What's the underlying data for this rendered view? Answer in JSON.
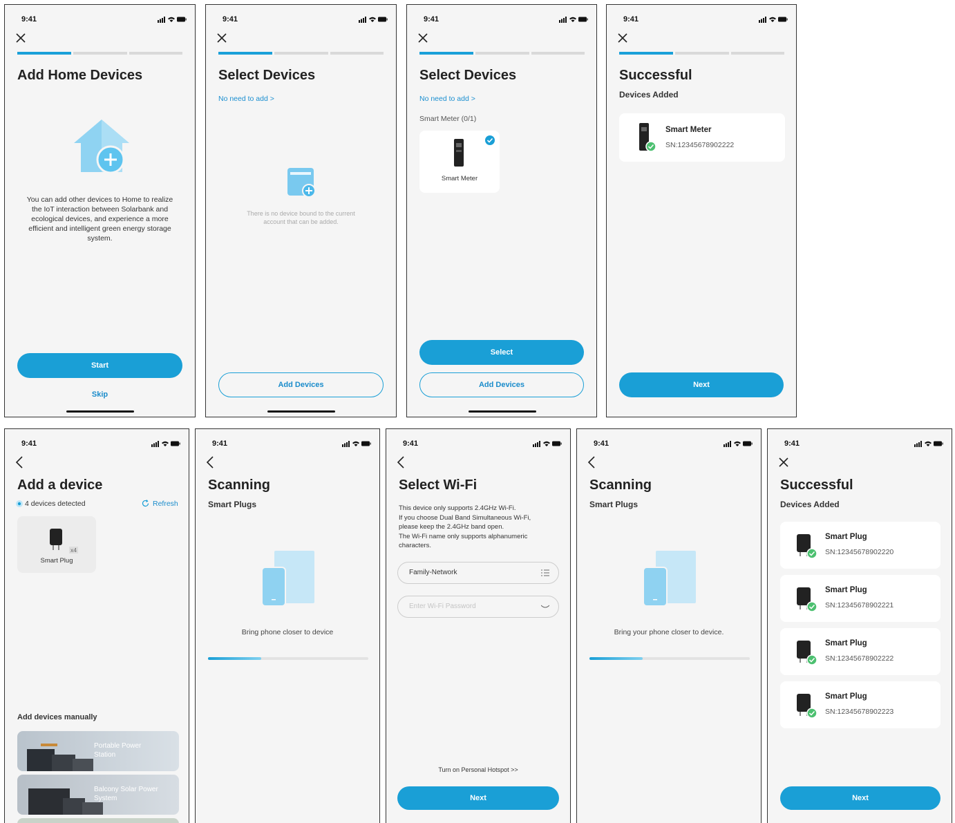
{
  "status_time": "9:41",
  "screens": {
    "s1": {
      "title": "Add Home Devices",
      "desc": "You can add other devices to Home to realize the IoT interaction between Solarbank and ecological devices, and experience a more efficient and intelligent green energy storage system.",
      "start": "Start",
      "skip": "Skip"
    },
    "s2": {
      "title": "Select Devices",
      "link": "No need to add >",
      "empty": "There is no device bound to the current account that can be added.",
      "add": "Add Devices"
    },
    "s3": {
      "title": "Select Devices",
      "link": "No need to add >",
      "group": "Smart Meter (0/1)",
      "device": "Smart Meter",
      "select": "Select",
      "add": "Add Devices"
    },
    "s4": {
      "title": "Successful",
      "subtitle": "Devices Added",
      "device": "Smart Meter",
      "sn": "SN:12345678902222",
      "next": "Next"
    },
    "s5": {
      "title": "Add a device",
      "detected": "4 devices detected",
      "refresh": "Refresh",
      "device": "Smart Plug",
      "count": "x4",
      "manual": "Add devices manually",
      "cats": [
        "Portable Power Station",
        "Balcony Solar Power System"
      ]
    },
    "s6": {
      "title": "Scanning",
      "subtitle": "Smart Plugs",
      "hint": "Bring phone closer to device",
      "progress": 0.33
    },
    "s7": {
      "title": "Select Wi-Fi",
      "desc": [
        "This device only supports 2.4GHz Wi-Fi.",
        "If you choose Dual Band Simultaneous Wi-Fi,",
        "please keep the 2.4GHz band open.",
        "The Wi-Fi name only supports alphanumeric",
        "characters."
      ],
      "network": "Family-Network",
      "password_placeholder": "Enter Wi-Fi Password",
      "hotspot": "Turn on Personal Hotspot >>",
      "next": "Next"
    },
    "s8": {
      "title": "Scanning",
      "subtitle": "Smart Plugs",
      "hint": "Bring your phone closer to device.",
      "progress": 0.33
    },
    "s9": {
      "title": "Successful",
      "subtitle": "Devices Added",
      "devices": [
        {
          "name": "Smart Plug",
          "sn": "SN:12345678902220"
        },
        {
          "name": "Smart Plug",
          "sn": "SN:12345678902221"
        },
        {
          "name": "Smart Plug",
          "sn": "SN:12345678902222"
        },
        {
          "name": "Smart Plug",
          "sn": "SN:12345678902223"
        }
      ],
      "next": "Next"
    }
  },
  "colors": {
    "accent": "#1a9fd6",
    "success": "#4cc070"
  }
}
